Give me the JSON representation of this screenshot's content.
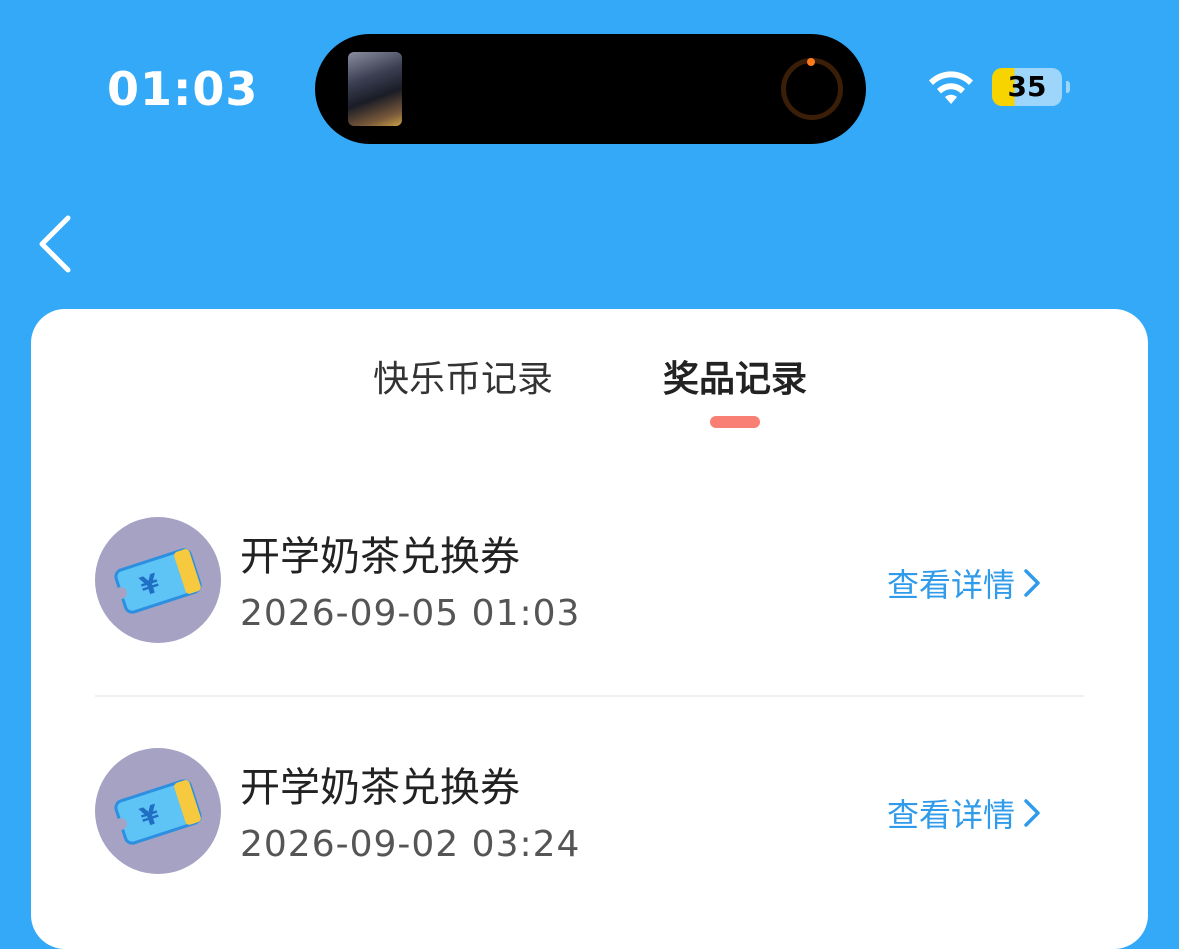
{
  "status_bar": {
    "time": "01:03",
    "battery": "35",
    "battery_color": "#F7D300"
  },
  "header": {
    "background": "#33A9F7",
    "back_icon": "chevron-left-icon"
  },
  "tabs": [
    {
      "label": "快乐币记录",
      "active": false
    },
    {
      "label": "奖品记录",
      "active": true
    }
  ],
  "records": [
    {
      "title": "开学奶茶兑换券",
      "time": "2026-09-05 01:03",
      "detail_label": "查看详情",
      "icon": "ticket-icon"
    },
    {
      "title": "开学奶茶兑换券",
      "time": "2026-09-02 03:24",
      "detail_label": "查看详情",
      "icon": "ticket-icon"
    }
  ],
  "colors": {
    "accent_blue": "#2F9BEA",
    "tab_indicator": "#F97F74"
  }
}
